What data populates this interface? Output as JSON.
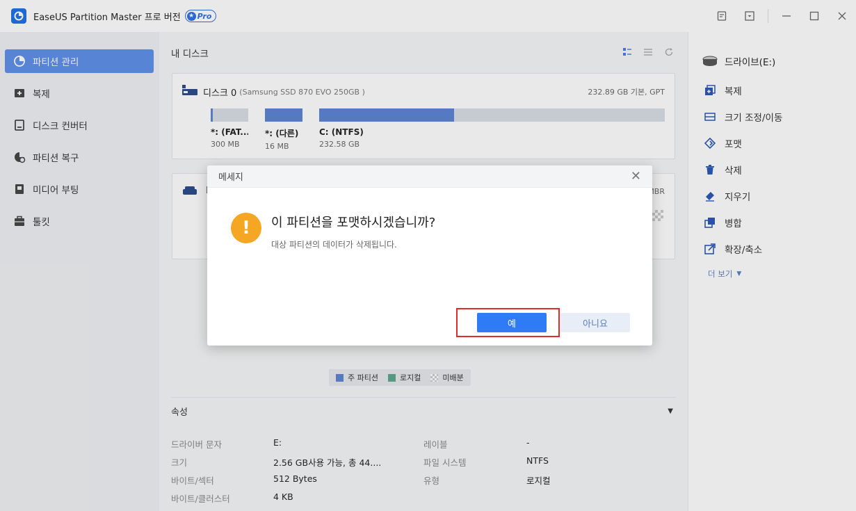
{
  "app": {
    "title": "EaseUS Partition Master 프로 버전",
    "pro_label": "Pro"
  },
  "sidebar": {
    "items": [
      {
        "label": "파티션 관리",
        "icon": "pie-chart-icon",
        "active": true
      },
      {
        "label": "복제",
        "icon": "clone-icon"
      },
      {
        "label": "디스크 컨버터",
        "icon": "disk-convert-icon"
      },
      {
        "label": "파티션 복구",
        "icon": "partition-recovery-icon"
      },
      {
        "label": "미디어 부팅",
        "icon": "media-boot-icon"
      },
      {
        "label": "툴킷",
        "icon": "toolkit-icon"
      }
    ]
  },
  "main": {
    "title": "내 디스크",
    "disk0": {
      "name": "디스크 0",
      "model": "(Samsung SSD 870 EVO 250GB )",
      "info": "232.89 GB 기본, GPT",
      "partitions": [
        {
          "label": "*: (FAT...",
          "size": "300 MB",
          "used_fraction": 0.05
        },
        {
          "label": "*: (다른)",
          "size": "16 MB",
          "used_fraction": 1.0
        },
        {
          "label": "C: (NTFS)",
          "size": "232.58 GB",
          "used_fraction": 0.39
        }
      ]
    },
    "disk1": {
      "name": "I",
      "info": "MBR"
    },
    "legend": {
      "primary": "주 파티션",
      "logical": "로지컬",
      "unallocated": "미배분"
    },
    "props": {
      "title": "속성",
      "rows": [
        {
          "k1": "드라이버 문자",
          "v1": "E:",
          "k2": "레이블",
          "v2": "-"
        },
        {
          "k1": "크기",
          "v1": "2.56 GB사용 가능, 총 44....",
          "k2": "파일 시스템",
          "v2": "NTFS"
        },
        {
          "k1": "바이트/섹터",
          "v1": "512 Bytes",
          "k2": "유형",
          "v2": "로지컬"
        },
        {
          "k1": "바이트/클러스터",
          "v1": "4 KB",
          "k2": "",
          "v2": ""
        }
      ]
    }
  },
  "right_panel": {
    "drive": "드라이브(E:)",
    "actions": [
      "복제",
      "크기 조정/이동",
      "포맷",
      "삭제",
      "지우기",
      "병합",
      "확장/축소"
    ],
    "more": "더 보기"
  },
  "dialog": {
    "title": "메세지",
    "question": "이 파티션을 포맷하시겠습니까?",
    "message": "대상 파티션의 데이터가 삭제됩니다.",
    "yes": "예",
    "no": "아니요"
  },
  "colors": {
    "accent": "#2f7bf6",
    "primary_partition": "#5b84d3",
    "logical_partition": "#5aa88c",
    "warning": "#f5a623",
    "highlight": "#e02b2b"
  }
}
